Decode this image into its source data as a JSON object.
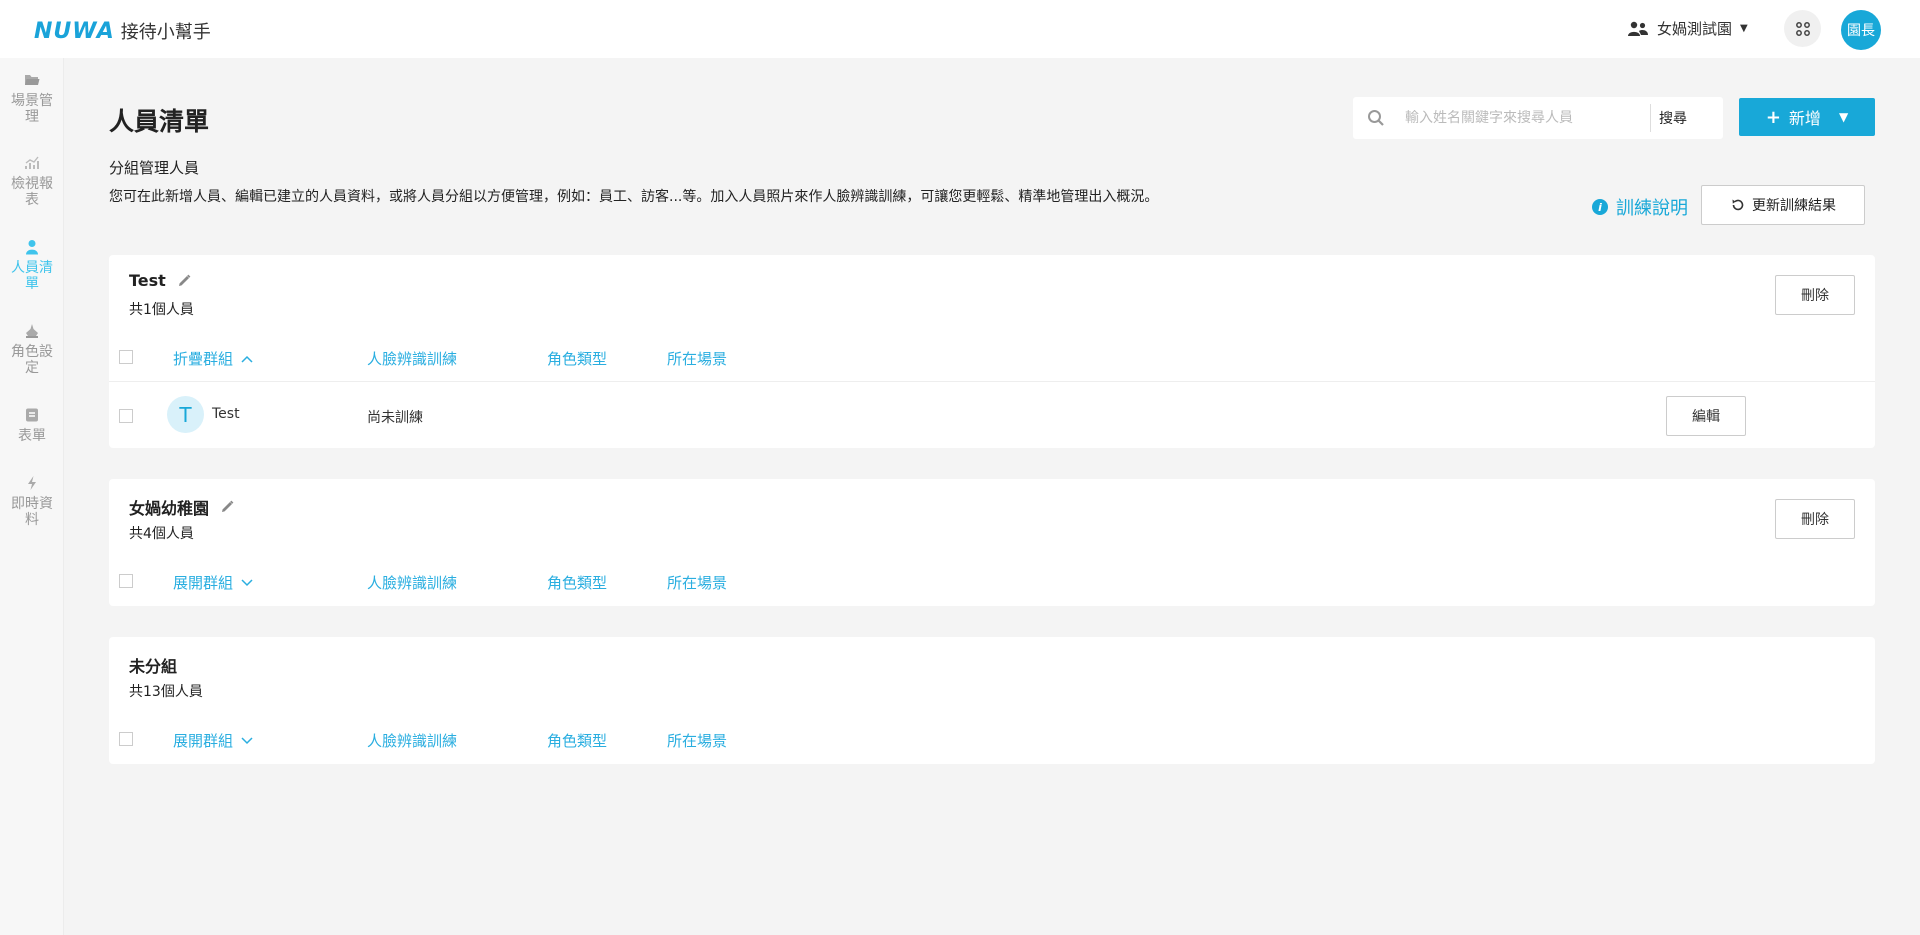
{
  "header": {
    "logo": "NUWA",
    "app_name": "接待小幫手",
    "org_name": "女媧測試園",
    "apps_icon": "grid-icon",
    "user_avatar_text": "園長"
  },
  "sidebar": {
    "items": [
      {
        "label": "場景管理",
        "icon": "folder-icon",
        "active": false
      },
      {
        "label": "檢視報表",
        "icon": "chart-icon",
        "active": false
      },
      {
        "label": "人員清單",
        "icon": "person-icon",
        "active": true
      },
      {
        "label": "角色設定",
        "icon": "role-icon",
        "active": false
      },
      {
        "label": "表單",
        "icon": "form-icon",
        "active": false
      },
      {
        "label": "即時資料",
        "icon": "bolt-icon",
        "active": false
      }
    ]
  },
  "page": {
    "title": "人員清單",
    "subtitle": "分組管理人員",
    "description": "您可在此新增人員、編輯已建立的人員資料，或將人員分組以方便管理，例如：員工、訪客...等。加入人員照片來作人臉辨識訓練，可讓您更輕鬆、精準地管理出入概況。",
    "search_placeholder": "輸入姓名關鍵字來搜尋人員",
    "search_button": "搜尋",
    "add_button": "新增",
    "train_help": "訓練說明",
    "refresh_button": "更新訓練結果"
  },
  "columns": {
    "face_training": "人臉辨識訓練",
    "role_type": "角色類型",
    "location": "所在場景"
  },
  "groups": [
    {
      "name": "Test",
      "count": "共1個人員",
      "toggle": "折疊群組",
      "delete": "刪除",
      "people": [
        {
          "initial": "T",
          "name": "Test",
          "training": "尚未訓練",
          "edit": "編輯"
        }
      ]
    },
    {
      "name": "女媧幼稚園",
      "count": "共4個人員",
      "toggle": "展開群組",
      "delete": "刪除"
    },
    {
      "name": "未分組",
      "count": "共13個人員",
      "toggle": "展開群組"
    }
  ],
  "colors": {
    "accent": "#18a8d8",
    "link": "#2aaee0",
    "sidebar_active": "#3fc4ec"
  }
}
